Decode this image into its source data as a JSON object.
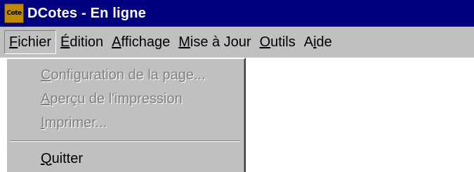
{
  "window": {
    "icon_label": "Cote",
    "title": "DCotes - En ligne",
    "colors": {
      "titlebar": "#000080",
      "face": "#c0c0c0",
      "disabled_text": "#808080"
    }
  },
  "menubar": {
    "items": [
      {
        "mnemonic": "F",
        "rest": "ichier"
      },
      {
        "mnemonic": "É",
        "rest": "dition"
      },
      {
        "mnemonic": "A",
        "rest": "ffichage"
      },
      {
        "mnemonic": "M",
        "rest": "ise à Jour"
      },
      {
        "mnemonic": "O",
        "rest": "utils"
      },
      {
        "pre": "A",
        "mnemonic": "i",
        "rest": "de"
      }
    ]
  },
  "file_menu": {
    "items": [
      {
        "mnemonic": "C",
        "rest": "onfiguration de la page...",
        "enabled": false
      },
      {
        "mnemonic": "A",
        "rest": "perçu de l'impression",
        "enabled": false
      },
      {
        "mnemonic": "I",
        "rest": "mprimer...",
        "enabled": false
      },
      {
        "mnemonic": "Q",
        "rest": "uitter",
        "enabled": true
      }
    ]
  }
}
